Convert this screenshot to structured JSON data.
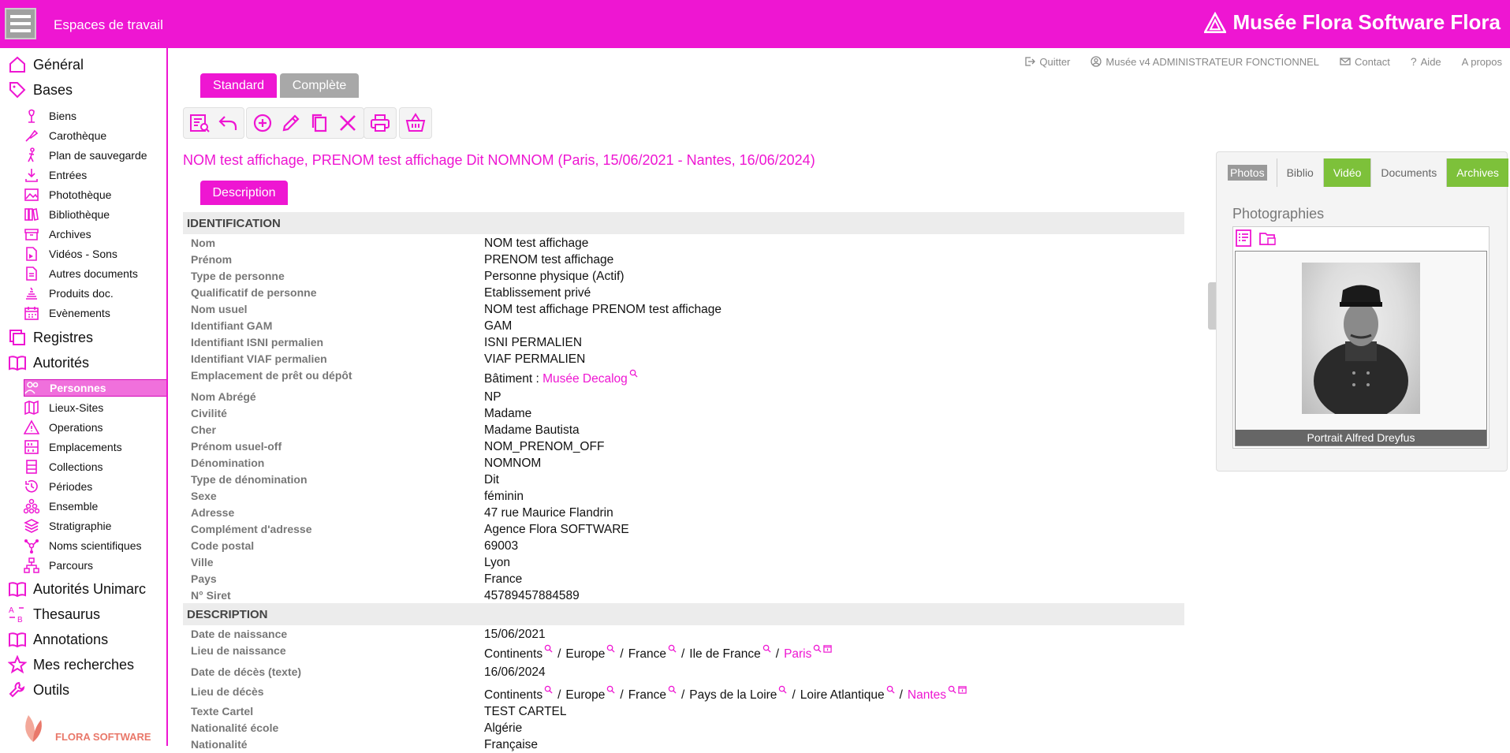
{
  "header": {
    "workspace_label": "Espaces de travail",
    "brand": "Musée Flora Software Flora"
  },
  "top_menu": [
    {
      "label": "Quitter",
      "icon": "exit-icon"
    },
    {
      "label": "Musée v4 ADMINISTRATEUR FONCTIONNEL",
      "icon": "user-circle-icon"
    },
    {
      "label": "Contact",
      "icon": "mail-icon"
    },
    {
      "label": "Aide",
      "icon": "question-icon"
    },
    {
      "label": "A propos",
      "icon": ""
    }
  ],
  "sidebar": {
    "general": "Général",
    "bases": "Bases",
    "bases_items": [
      "Biens",
      "Carothèque",
      "Plan de sauvegarde",
      "Entrées",
      "Photothèque",
      "Bibliothèque",
      "Archives",
      "Vidéos - Sons",
      "Autres documents",
      "Produits doc.",
      "Evènements"
    ],
    "registres": "Registres",
    "autorites": "Autorités",
    "autorites_items": [
      "Personnes",
      "Lieux-Sites",
      "Operations",
      "Emplacements",
      "Collections",
      "Périodes",
      "Ensemble",
      "Stratigraphie",
      "Noms scientifiques",
      "Parcours"
    ],
    "autorites_unimarc": "Autorités Unimarc",
    "thesaurus": "Thesaurus",
    "annotations": "Annotations",
    "mes_recherches": "Mes recherches",
    "outils": "Outils",
    "logo_text": "FLORA SOFTWARE"
  },
  "view_tabs": {
    "standard": "Standard",
    "complete": "Complète"
  },
  "record_title": "NOM test affichage, PRENOM test affichage Dit NOMNOM (Paris, 15/06/2021 - Nantes, 16/06/2024)",
  "sub_tab": "Description",
  "sections": {
    "identification": "IDENTIFICATION",
    "description": "DESCRIPTION"
  },
  "identification": [
    {
      "label": "Nom",
      "value": "NOM test affichage"
    },
    {
      "label": "Prénom",
      "value": "PRENOM test affichage"
    },
    {
      "label": "Type de personne",
      "value": "Personne physique (Actif)"
    },
    {
      "label": "Qualificatif de personne",
      "value": "Etablissement privé"
    },
    {
      "label": "Nom usuel",
      "value": "NOM test affichage PRENOM test affichage"
    },
    {
      "label": "Identifiant GAM",
      "value": "GAM"
    },
    {
      "label": "Identifiant ISNI permalien",
      "value": "ISNI PERMALIEN"
    },
    {
      "label": "Identifiant VIAF permalien",
      "value": "VIAF PERMALIEN"
    },
    {
      "label": "Emplacement de prêt ou dépôt",
      "value_prefix": "Bâtiment : ",
      "value_link": "Musée Decalog"
    },
    {
      "label": "Nom Abrégé",
      "value": "NP"
    },
    {
      "label": "Civilité",
      "value": "Madame"
    },
    {
      "label": "Cher",
      "value": "Madame Bautista"
    },
    {
      "label": "Prénom usuel-off",
      "value": "NOM_PRENOM_OFF"
    },
    {
      "label": "Dénomination",
      "value": "NOMNOM"
    },
    {
      "label": "Type de dénomination",
      "value": "Dit"
    },
    {
      "label": "Sexe",
      "value": "féminin"
    },
    {
      "label": "Adresse",
      "value": "47 rue Maurice Flandrin"
    },
    {
      "label": "Complément d'adresse",
      "value": "Agence Flora SOFTWARE"
    },
    {
      "label": "Code postal",
      "value": "69003"
    },
    {
      "label": "Ville",
      "value": "Lyon"
    },
    {
      "label": "Pays",
      "value": "France"
    },
    {
      "label": "N° Siret",
      "value": "45789457884589"
    }
  ],
  "description": [
    {
      "label": "Date de naissance",
      "value": "15/06/2021"
    },
    {
      "label": "Lieu de naissance",
      "path": [
        "Continents",
        "Europe",
        "France",
        "Ile de France"
      ],
      "link": "Paris"
    },
    {
      "label": "Date de décès (texte)",
      "value": "16/06/2024"
    },
    {
      "label": "Lieu de décès",
      "path": [
        "Continents",
        "Europe",
        "France",
        "Pays de la Loire",
        "Loire Atlantique"
      ],
      "link": "Nantes"
    },
    {
      "label": "Texte Cartel",
      "value": "TEST CARTEL"
    },
    {
      "label": "Nationalité école",
      "value": "Algérie"
    },
    {
      "label": "Nationalité",
      "value": "Française"
    }
  ],
  "panel": {
    "tabs": [
      "Photos",
      "Biblio",
      "Vidéo",
      "Documents",
      "Archives"
    ],
    "title": "Photographies",
    "caption": "Portrait Alfred Dreyfus"
  },
  "colors": {
    "accent": "#ee16d2",
    "green": "#7dc13a"
  }
}
